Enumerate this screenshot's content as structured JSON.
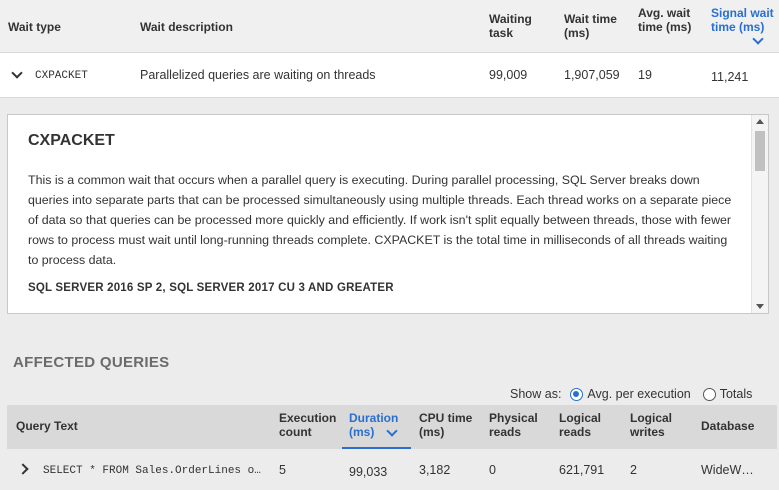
{
  "waits_table": {
    "columns": {
      "wait_type": "Wait type",
      "wait_description": "Wait description",
      "waiting_task": [
        "Waiting",
        "task"
      ],
      "wait_time": [
        "Wait time",
        "(ms)"
      ],
      "avg_wait_time": [
        "Avg. wait",
        "time (ms)"
      ],
      "signal_wait_time": [
        "Signal wait",
        "time (ms)"
      ]
    },
    "sorted_by": "signal_wait_time",
    "row": {
      "wait_type": "CXPACKET",
      "wait_description": "Parallelized queries are waiting on threads",
      "waiting_task": "99,009",
      "wait_time": "1,907,059",
      "avg_wait_time": "19",
      "signal_wait_time": "11,241",
      "expanded": true
    }
  },
  "description_panel": {
    "title": "CXPACKET",
    "body": "This is a common wait that occurs when a parallel query is executing. During parallel processing, SQL Server breaks down queries into separate parts that can be processed simultaneously using multiple threads. Each thread works on a separate piece of data so that queries can be processed more quickly and efficiently. If work isn't split equally between threads, those with fewer rows to process must wait until long-running threads complete. CXPACKET is the total time in milliseconds of all threads waiting to process data.",
    "version_heading": "SQL SERVER 2016 SP 2, SQL SERVER 2017 CU 3 AND GREATER"
  },
  "affected_queries": {
    "title": "AFFECTED QUERIES",
    "show_as_label": "Show as:",
    "options": [
      {
        "label": "Avg. per execution",
        "checked": true
      },
      {
        "label": "Totals",
        "checked": false
      }
    ],
    "columns": {
      "query_text": "Query Text",
      "execution_count": [
        "Execution",
        "count"
      ],
      "duration": [
        "Duration",
        "(ms)"
      ],
      "cpu_time": [
        "CPU time",
        "(ms)"
      ],
      "physical_reads": [
        "Physical",
        "reads"
      ],
      "logical_reads": [
        "Logical",
        "reads"
      ],
      "logical_writes": [
        "Logical",
        "writes"
      ],
      "database": "Database"
    },
    "sorted_by": "duration",
    "rows": [
      {
        "query_text": "SELECT * FROM Sales.OrderLines o…",
        "execution_count": "5",
        "duration": "99,033",
        "cpu_time": "3,182",
        "physical_reads": "0",
        "logical_reads": "621,791",
        "logical_writes": "2",
        "database": "WideW…"
      }
    ]
  },
  "colors": {
    "accent": "#2a6fcf",
    "header_bg": "#f0f0f0",
    "page_bg": "#ececec",
    "section_title": "#6b6b6b"
  }
}
